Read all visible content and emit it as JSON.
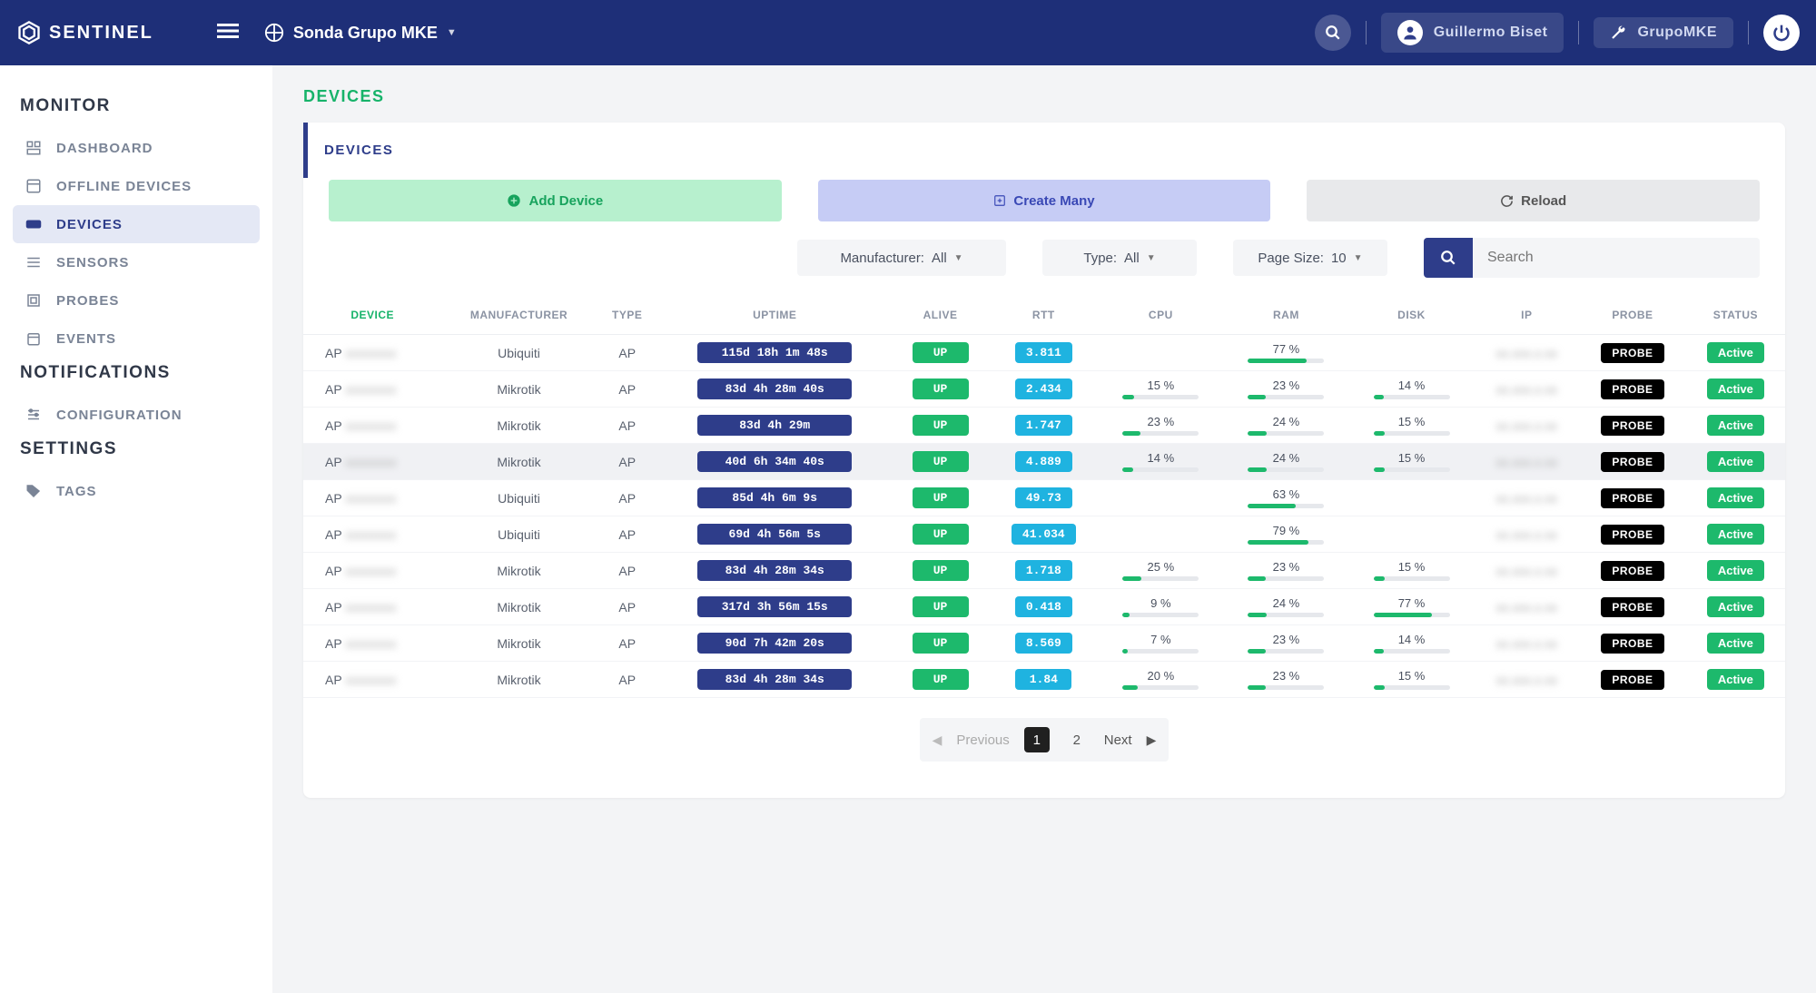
{
  "header": {
    "brand": "SENTINEL",
    "probe_label": "Sonda Grupo MKE",
    "user_name": "Guillermo Biset",
    "org_name": "GrupoMKE"
  },
  "sidebar": {
    "sections": [
      {
        "title": "MONITOR",
        "items": [
          {
            "label": "DASHBOARD",
            "icon": "dashboard"
          },
          {
            "label": "OFFLINE DEVICES",
            "icon": "offline"
          },
          {
            "label": "DEVICES",
            "icon": "devices",
            "active": true
          },
          {
            "label": "SENSORS",
            "icon": "sensors"
          },
          {
            "label": "PROBES",
            "icon": "probes"
          },
          {
            "label": "EVENTS",
            "icon": "events"
          }
        ]
      },
      {
        "title": "NOTIFICATIONS",
        "items": [
          {
            "label": "CONFIGURATION",
            "icon": "config"
          }
        ]
      },
      {
        "title": "SETTINGS",
        "items": [
          {
            "label": "TAGS",
            "icon": "tags"
          }
        ]
      }
    ]
  },
  "page": {
    "title": "DEVICES",
    "tab": "DEVICES",
    "actions": {
      "add": "Add Device",
      "create": "Create Many",
      "reload": "Reload"
    },
    "filters": {
      "manufacturer_label": "Manufacturer:",
      "manufacturer_value": "All",
      "type_label": "Type:",
      "type_value": "All",
      "pagesize_label": "Page Size:",
      "pagesize_value": "10",
      "search_placeholder": "Search"
    },
    "columns": [
      "DEVICE",
      "MANUFACTURER",
      "TYPE",
      "UPTIME",
      "ALIVE",
      "RTT",
      "CPU",
      "RAM",
      "DISK",
      "IP",
      "PROBE",
      "STATUS"
    ],
    "rows": [
      {
        "device": "AP",
        "manufacturer": "Ubiquiti",
        "type": "AP",
        "uptime": "115d 18h 1m 48s",
        "alive": "UP",
        "rtt": "3.811",
        "cpu": null,
        "ram": 77,
        "disk": null,
        "ip": "",
        "probe": "PROBE",
        "status": "Active"
      },
      {
        "device": "AP",
        "manufacturer": "Mikrotik",
        "type": "AP",
        "uptime": "83d 4h 28m 40s",
        "alive": "UP",
        "rtt": "2.434",
        "cpu": 15,
        "ram": 23,
        "disk": 14,
        "ip": "",
        "probe": "PROBE",
        "status": "Active"
      },
      {
        "device": "AP",
        "manufacturer": "Mikrotik",
        "type": "AP",
        "uptime": "83d 4h 29m",
        "alive": "UP",
        "rtt": "1.747",
        "cpu": 23,
        "ram": 24,
        "disk": 15,
        "ip": "",
        "probe": "PROBE",
        "status": "Active"
      },
      {
        "device": "AP",
        "manufacturer": "Mikrotik",
        "type": "AP",
        "uptime": "40d 6h 34m 40s",
        "alive": "UP",
        "rtt": "4.889",
        "cpu": 14,
        "ram": 24,
        "disk": 15,
        "ip": "",
        "probe": "PROBE",
        "status": "Active",
        "hovered": true
      },
      {
        "device": "AP",
        "manufacturer": "Ubiquiti",
        "type": "AP",
        "uptime": "85d 4h 6m 9s",
        "alive": "UP",
        "rtt": "49.73",
        "cpu": null,
        "ram": 63,
        "disk": null,
        "ip": "",
        "probe": "PROBE",
        "status": "Active"
      },
      {
        "device": "AP",
        "manufacturer": "Ubiquiti",
        "type": "AP",
        "uptime": "69d 4h 56m 5s",
        "alive": "UP",
        "rtt": "41.034",
        "cpu": null,
        "ram": 79,
        "disk": null,
        "ip": "",
        "probe": "PROBE",
        "status": "Active"
      },
      {
        "device": "AP",
        "manufacturer": "Mikrotik",
        "type": "AP",
        "uptime": "83d 4h 28m 34s",
        "alive": "UP",
        "rtt": "1.718",
        "cpu": 25,
        "ram": 23,
        "disk": 15,
        "ip": "",
        "probe": "PROBE",
        "status": "Active"
      },
      {
        "device": "AP",
        "manufacturer": "Mikrotik",
        "type": "AP",
        "uptime": "317d 3h 56m 15s",
        "alive": "UP",
        "rtt": "0.418",
        "cpu": 9,
        "ram": 24,
        "disk": 77,
        "ip": "",
        "probe": "PROBE",
        "status": "Active"
      },
      {
        "device": "AP",
        "manufacturer": "Mikrotik",
        "type": "AP",
        "uptime": "90d 7h 42m 20s",
        "alive": "UP",
        "rtt": "8.569",
        "cpu": 7,
        "ram": 23,
        "disk": 14,
        "ip": "",
        "probe": "PROBE",
        "status": "Active"
      },
      {
        "device": "AP",
        "manufacturer": "Mikrotik",
        "type": "AP",
        "uptime": "83d 4h 28m 34s",
        "alive": "UP",
        "rtt": "1.84",
        "cpu": 20,
        "ram": 23,
        "disk": 15,
        "ip": "",
        "probe": "PROBE",
        "status": "Active"
      }
    ],
    "pagination": {
      "prev": "Previous",
      "next": "Next",
      "pages": [
        "1",
        "2"
      ],
      "current": "1"
    }
  }
}
